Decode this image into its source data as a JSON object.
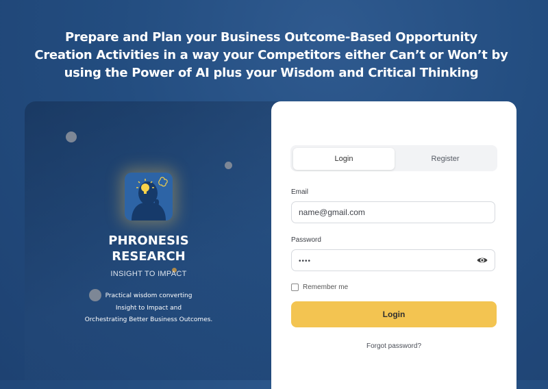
{
  "headline": {
    "line1": "Prepare and Plan your Business Outcome-Based Opportunity",
    "line2": "Creation Activities in a way your Competitors either Can’t or Won’t by",
    "line3": "using the Power of AI plus your Wisdom and Critical Thinking"
  },
  "brand": {
    "name_line1": "PHRONESIS",
    "name_line2": "RESEARCH",
    "tagline": "INSIGHT TO IMPACT",
    "desc_line1": "Practical wisdom converting",
    "desc_line2": "Insight to Impact and",
    "desc_line3": "Orchestrating Better Business Outcomes."
  },
  "auth": {
    "tabs": [
      {
        "label": "Login",
        "active": true
      },
      {
        "label": "Register",
        "active": false
      }
    ],
    "email_label": "Email",
    "email_value": "name@gmail.com",
    "password_label": "Password",
    "password_value": "••••",
    "remember_label": "Remember me",
    "login_button": "Login",
    "forgot_link": "Forgot password?"
  },
  "colors": {
    "accent": "#f3c451",
    "background": "#234d80",
    "card": "#ffffff"
  }
}
